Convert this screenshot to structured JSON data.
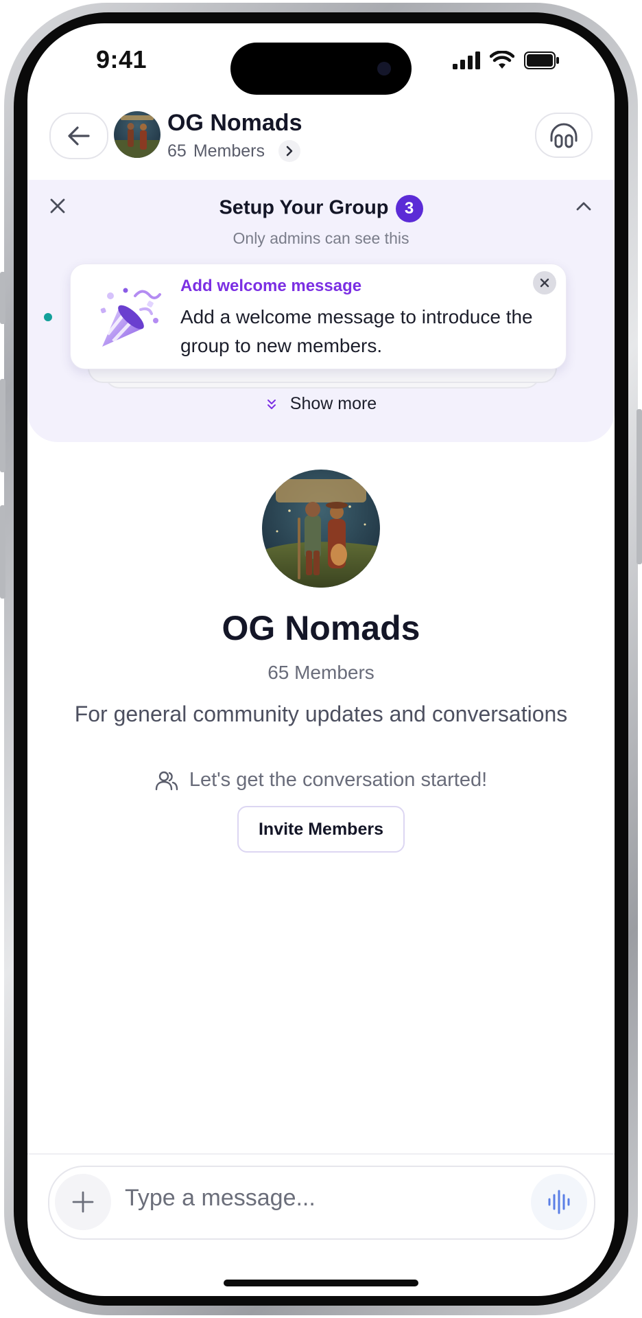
{
  "status_bar": {
    "time": "9:41"
  },
  "header": {
    "group_name": "OG Nomads",
    "member_count": "65",
    "members_label": "Members"
  },
  "setup": {
    "title": "Setup Your Group",
    "badge_count": "3",
    "note": "Only admins can see this",
    "card": {
      "title": "Add welcome message",
      "text": "Add a welcome message to introduce the group to new members."
    },
    "show_more": "Show more"
  },
  "group": {
    "name": "OG Nomads",
    "members": "65 Members",
    "description": "For general community updates and conversations",
    "prompt": "Let's get the conversation started!",
    "invite_label": "Invite Members"
  },
  "composer": {
    "placeholder": "Type a message..."
  },
  "colors": {
    "accent": "#5b2bd6",
    "card_title": "#7b2fe3",
    "setup_bg": "#f3f1fc",
    "dot": "#13a09a"
  },
  "icons": [
    "back-arrow-icon",
    "headphones-icon",
    "chevron-right-icon",
    "close-icon",
    "chevron-up-icon",
    "party-popper-icon",
    "double-chevron-down-icon",
    "people-icon",
    "plus-icon",
    "voice-wave-icon"
  ]
}
